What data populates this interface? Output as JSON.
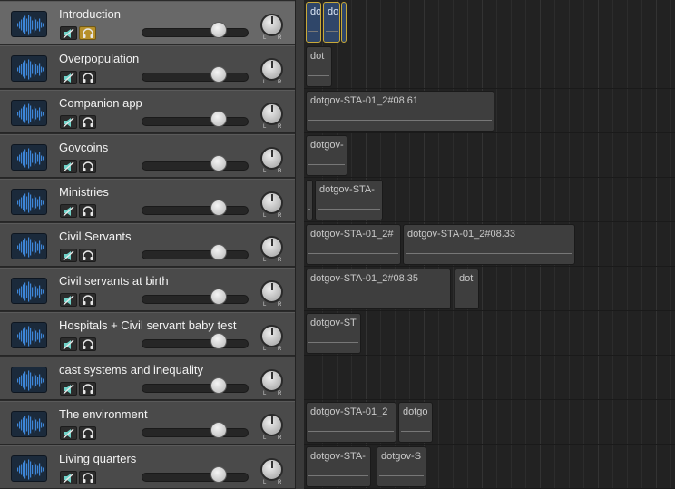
{
  "colors": {
    "track_bg": "#4a4a4a",
    "track_selected_bg": "#686868",
    "solo_active": "#b7902a",
    "region_selected": "#2f4669",
    "playhead": "#d8c24a",
    "waveform_icon": "#3d86d8"
  },
  "tracks": [
    {
      "name": "Introduction",
      "selected": true,
      "solo_on": true,
      "volume": 0.75,
      "regions": [
        {
          "label": "do",
          "selected": true
        },
        {
          "label": "do",
          "selected": true
        },
        {
          "label": "",
          "selected": true
        }
      ]
    },
    {
      "name": "Overpopulation",
      "selected": false,
      "solo_on": false,
      "volume": 0.75,
      "regions": [
        {
          "label": "dot",
          "selected": false
        }
      ]
    },
    {
      "name": "Companion app",
      "selected": false,
      "solo_on": false,
      "volume": 0.75,
      "regions": [
        {
          "label": "dotgov-STA-01_2#08.61",
          "selected": false
        }
      ]
    },
    {
      "name": "Govcoins",
      "selected": false,
      "solo_on": false,
      "volume": 0.75,
      "regions": [
        {
          "label": "dotgov-",
          "selected": false
        }
      ]
    },
    {
      "name": "Ministries",
      "selected": false,
      "solo_on": false,
      "volume": 0.75,
      "regions": [
        {
          "label": "",
          "selected": false
        },
        {
          "label": "dotgov-STA-",
          "selected": false
        }
      ]
    },
    {
      "name": "Civil Servants",
      "selected": false,
      "solo_on": false,
      "volume": 0.75,
      "regions": [
        {
          "label": "dotgov-STA-01_2#",
          "selected": false
        },
        {
          "label": "dotgov-STA-01_2#08.33",
          "selected": false
        }
      ]
    },
    {
      "name": "Civil servants at birth",
      "selected": false,
      "solo_on": false,
      "volume": 0.75,
      "regions": [
        {
          "label": "dotgov-STA-01_2#08.35",
          "selected": false
        },
        {
          "label": "dot",
          "selected": false
        }
      ]
    },
    {
      "name": "Hospitals + Civil servant baby test",
      "selected": false,
      "solo_on": false,
      "volume": 0.75,
      "regions": [
        {
          "label": "dotgov-ST",
          "selected": false
        }
      ]
    },
    {
      "name": "cast systems and inequality",
      "selected": false,
      "solo_on": false,
      "volume": 0.75,
      "regions": []
    },
    {
      "name": "The environment",
      "selected": false,
      "solo_on": false,
      "volume": 0.75,
      "regions": [
        {
          "label": "dotgov-STA-01_2",
          "selected": false
        },
        {
          "label": "dotgo",
          "selected": false
        }
      ]
    },
    {
      "name": "Living quarters",
      "selected": false,
      "solo_on": false,
      "volume": 0.75,
      "regions": [
        {
          "label": "dotgov-STA-",
          "selected": false
        },
        {
          "label": "dotgov-S",
          "selected": false
        }
      ]
    }
  ],
  "pan_labels": {
    "left": "L",
    "right": "R"
  },
  "icons": {
    "track_icon": "audio-waveform-icon",
    "mute": "mute-speaker-icon",
    "solo": "headphones-icon"
  }
}
